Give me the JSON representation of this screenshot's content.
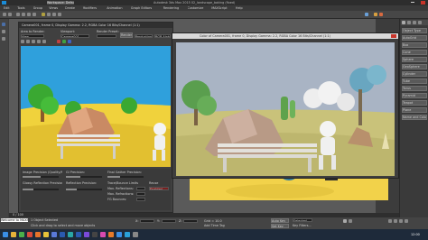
{
  "app": {
    "title": "Autodesk 3ds Max 2015   02_landscape_baking (fixed)",
    "workspace": "Workspace: Default",
    "colors": {
      "app_bg": "#3c3c3c",
      "titlebar": "#2d2d2d",
      "ribbon": "#474747",
      "accent": "#2a6fcf"
    }
  },
  "main_menu": {
    "items": [
      "Edit",
      "Tools",
      "Group",
      "Views",
      "Create",
      "Modifiers",
      "Animation",
      "Graph Editors",
      "Rendering",
      "Customize",
      "MAXScript",
      "Help"
    ]
  },
  "frame_window_1": {
    "title": "Camera001, frame 0, Display Gamma: 2.2, RGBA Color 16 Bits/Channel (1:1)",
    "toolbar": {
      "area_label": "Area to Render:",
      "area_value": "View",
      "viewport_label": "Viewport:",
      "viewport_value": "Camera001",
      "preset_label": "Render Preset:",
      "preset_value": "------",
      "render_button": "Render",
      "production_value": "Production",
      "channel_value": "RGB Alpha"
    },
    "settings": {
      "image_precision_label": "Image Precision (Quality/Noise):",
      "gi_precision_label": "GI Precision:",
      "final_gather_label": "Final Gather Precision:",
      "glossy_label": "Glossy Reflection Precision:",
      "reflection_label": "Reflection Precision:",
      "trace_label": "Trace/Bounce Limits",
      "max_reflections_label": "Max. Reflections:",
      "max_refractions_label": "Max. Refractions:",
      "fg_bounces_label": "FG Bounces:",
      "reuse_label": "Reuse",
      "reuse_value": "Enabled"
    }
  },
  "frame_window_2": {
    "title": "Color of Camera001, frame 0, Display Gamma: 2.2, RGBA Color 16 Bits/Channel (1:1)"
  },
  "command_panel": {
    "items": [
      "Object Type",
      "AutoGrid",
      "Box",
      "Cone",
      "Sphere",
      "GeoSphere",
      "Cylinder",
      "Tube",
      "Torus",
      "Pyramid",
      "Teapot",
      "Plane",
      "Name and Color"
    ]
  },
  "status": {
    "selection": "1 Object Selected",
    "prompt": "Click and drag to select and move objects",
    "maxscript": "Welcome to MAXScript.",
    "frame_counter": "0 / 100",
    "x_label": "X:",
    "y_label": "Y:",
    "z_label": "Z:",
    "grid": "Grid = 10.0",
    "add_time_tag": "Add Time Tag",
    "auto_key": "Auto Key",
    "set_key": "Set Key",
    "selected": "Selected",
    "key_filters": "Key Filters..."
  },
  "taskbar": {
    "icons": [
      "start-icon",
      "explorer-icon",
      "browser-icon",
      "media-icon",
      "firefox-icon",
      "folder-icon",
      "mail-icon",
      "photoshop-icon",
      "max-icon",
      "word-icon",
      "chat-icon",
      "terminal-icon",
      "paint-icon",
      "vlc-icon",
      "store-icon",
      "skype-icon",
      "settings-icon"
    ],
    "time": "12:00"
  }
}
